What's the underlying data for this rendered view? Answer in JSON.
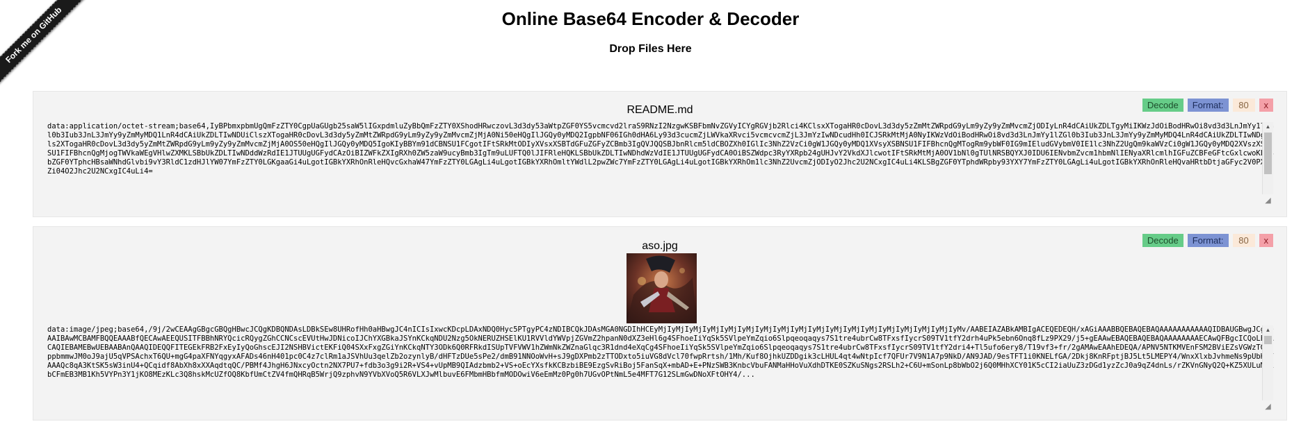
{
  "ribbon": {
    "label": "Fork me on GitHub"
  },
  "page": {
    "title": "Online Base64 Encoder & Decoder",
    "drop_label": "Drop Files Here"
  },
  "files": [
    {
      "name": "README.md",
      "decode_label": "Decode",
      "format_label": "Format:",
      "line_width": "80",
      "close_label": "x",
      "data": "data:application/octet-stream;base64,IyBPbmxpbmUgQmFzZTY0CgpUaGUgb25saW5lIGxpdmluZyBbQmFzZTY0XShodHRwczovL3d3dy53aWtpZGF0YS5vcmcvd2lraS9RNzI2NzgwKSBFbmNvZGVyICYgRGVjb2Rlci4KClsxXTogaHR0cDovL3d3dy5zZmMtZWRpdG9yLm9yZy9yZmMvcmZjODIyLnR4dCAiUkZDLTgyMiIKWzJdOiBodHRwOi8vd3d3LnJmYy1lZGl0b3Iub3JnL3JmYy9yZmMyMDQ1LnR4dCAiUkZDLTIwNDUiClszXTogaHR0cDovL3d3dy5yZmMtZWRpdG9yLm9yZy9yZmMvcmZjMjA0Ni50eHQgIlJGQy0yMDQ2IgpbNF06IGh0dHA6Ly93d3cucmZjLWVkaXRvci5vcmcvcmZjL3JmYzIwNDcudHh0ICJSRkMtMjA0NyIKWzVdOiBodHRwOi8vd3d3LnJmYy1lZGl0b3Iub3JnL3JmYy9yZmMyMDQ4LnR4dCAiUkZDLTIwNDgiCls2XTogaHR0cDovL3d3dy5yZmMtZWRpdG9yLm9yZy9yZmMvcmZjMjA0OS50eHQgIlJGQy0yMDQ5IgoKIyBBYm91dCBNSU1FCgotIFtSRkMtODIyXVsxXSBTdGFuZGFyZCBmb3IgQVJQQSBJbnRlcm5ldCBOZXh0IGlIc3NhZ2VzCi0gW1JGQy0yMDQ1XVsyXSBNSU1FIFBhcnQgMTogRm9ybWF0IG9mIEludGVybmV0IE1lc3NhZ2UgQm9kaWVzCi0gW1JGQy0yMDQ2XVszXSBNSU1FIFBhcnQgMjogTWVkaWEgVHlwZXMKLSBbUkZDLTIwNDddWzRdIE1JTUUgUGFydCAzOiBIZWFkZXIgRXh0ZW5zaW9ucyBmb3IgTm9uLUFTQ0lJIFRleHQKLSBbUkZDLTIwNDhdWzVdIE1JTUUgUGFydCA0OiBSZWdpc3RyYXRpb24gUHJvY2VkdXJlcwotIFtSRkMtMjA0OV1bNl0gTUlNRSBQYXJ0IDU6IENvbmZvcm1hbmNlIENyaXRlcmlhIGFuZCBFeGFtcGxlcwoKLSBbZGF0YTphcHBsaWNhdGlvbi9vY3RldC1zdHJlYW07YmFzZTY0LGKgaaGi4uLgotIGBkYXRhOnRleHQvcGxhaW47YmFzZTY0LGAgLi4uLgotIGBkYXRhOmltYWdlL2pwZWc7YmFzZTY0LGAgLi4uLgotIGBkYXRhOm1lc3NhZ2UvcmZjODIyO2Jhc2U2NCxgIC4uLi4KLSBgZGF0YTphdWRpby93YXY7YmFzZTY0LGAgLi4uLgotIGBkYXRhOnRleHQvaHRtbDtjaGFyc2V0PXV0Zi04O2Jhc2U2NCxgIC4uLi4="
    },
    {
      "name": "aso.jpg",
      "decode_label": "Decode",
      "format_label": "Format:",
      "line_width": "80",
      "close_label": "x",
      "data": "data:image/jpeg;base64,/9j/2wCEAAgGBgcGBQgHBwcJCQgKDBQNDAsLDBkSEw8UHRofHh0aHBwgJC4nICIsIxwcKDcpLDAxNDQ0Hyc5PTgyPC4zNDIBCQkJDAsMGA0NGDIhHCEyMjIyMjIyMjIyMjIyMjIyMjIyMjIyMjIyMjIyMjIyMjIyMjIyMjIyMjIyMjIyMjIyMjIyMv/AABEIAZABkAMBIgACEQEDEQH/xAGiAAABBQEBAQEBAQAAAAAAAAAAAQIDBAUGBwgJCgsQAAIBAwMCBAMFBQQEAAABfQECAwAEEQUSITFBBhNRYQcicRQygZGhCCNCscEVUtHwJDNicoIJChYXGBkaJSYnKCkqNDU2Nzg5OkNERUZHSElKU1RVVldYWVpjZGVmZ2hpanN0dXZ3eHl6g4SFhoeIiYqSk5SVlpeYmZqio6Slpqeoqaqys7S1tre4ubrCw8TFxsfIycrS09TV1tfY2drh4uPk5ebn6Onq8fLz9PX29/j5+gEAAwEBAQEBAQEBAQAAAAAAAAECAwQFBgcICQoLEQACAQIEBAMEBwUEBAABAnQAAQIDEQQFITEGEkFRB2FxEyIyQoGhscEJI2NSHBVictEKFiQ04SXxFxgZGiYnKCkqNTY3ODk6Q0RFRkdISUpTVFVWV1hZWmNkZWZnaGlqc3R1dnd4eXqCg4SFhoeIiYqSk5SVlpeYmZqio6Slpqeoqaqys7S1tre4ubrCw8TFxsfIycrS09TV1tfY2dri4+Tl5ufo6ery8/T19vf3+fr/2gAMAwEAAhEDEQA/APNV5NTKMVEnFSM2BViEZsVGWzTGfJppbmmwJM0oJ9ajU5qVPSAchxT6QU+mgG4paXFNYqgyxAFADs46nH401pc0C4z7clRm1aJSVhUu3qelZb2ozynlyB/dHFTzDUe5sPe2/dmB91NNOoWvH+sJ9gDXPmb2zTTODxto5iuVG8dVcl70fwpRrtsh/1Mh/Kuf8OjhkUZDDgik3cLHUL4qt4wNtpIcf7QFUr7V9N1A7p9NkD/AN9JAD/9esTFT1i0KNELfGA/2Dkj8KnRFptjBJ5Lt5LMEPY4/WnxXlxbJvhmeNs9pUbH6VAAAQc8qA3KtSK5sW3inU4+QCqidf8AbXh8xXXAqdtqQC/PBMf4JhgH6JNxcyOctn2NX7PU7+fdb3o3g9i2R+VS4+vUpMB9QIAdzbmb2+VS+oEcYXsfkKCBzbiBE9EzgSvRiBoj5FanSqX+mbAD+E+PNzSWB3KnbcVbuFANMaHHoVuXdhDTKE0SZKuSNgs2RSLh2+C6U+mSonLp8bWbO2j6Q0MHhXCY01K5cCI2iaUuZ3zDGd1yzZcJ0a9qZ4dnLs/rZKVnGNyQ2Q+KZ5XULuMDkbCFmEB3MB1Kh5VYPn3Y1jKO8MEzKLc3Q8hskMcUZfOQ8KbfUmCtZV4fmQHRqB5WrjQ9zphvN9YVbXVoQ5R6VLXJwMlbuvE6FMbmHBbfmMODOwiV6eEmMz0Pg0h7UGvOPtNmL5e4MFT7G12SLmGwDNoXFtOHY4/..."
    }
  ]
}
